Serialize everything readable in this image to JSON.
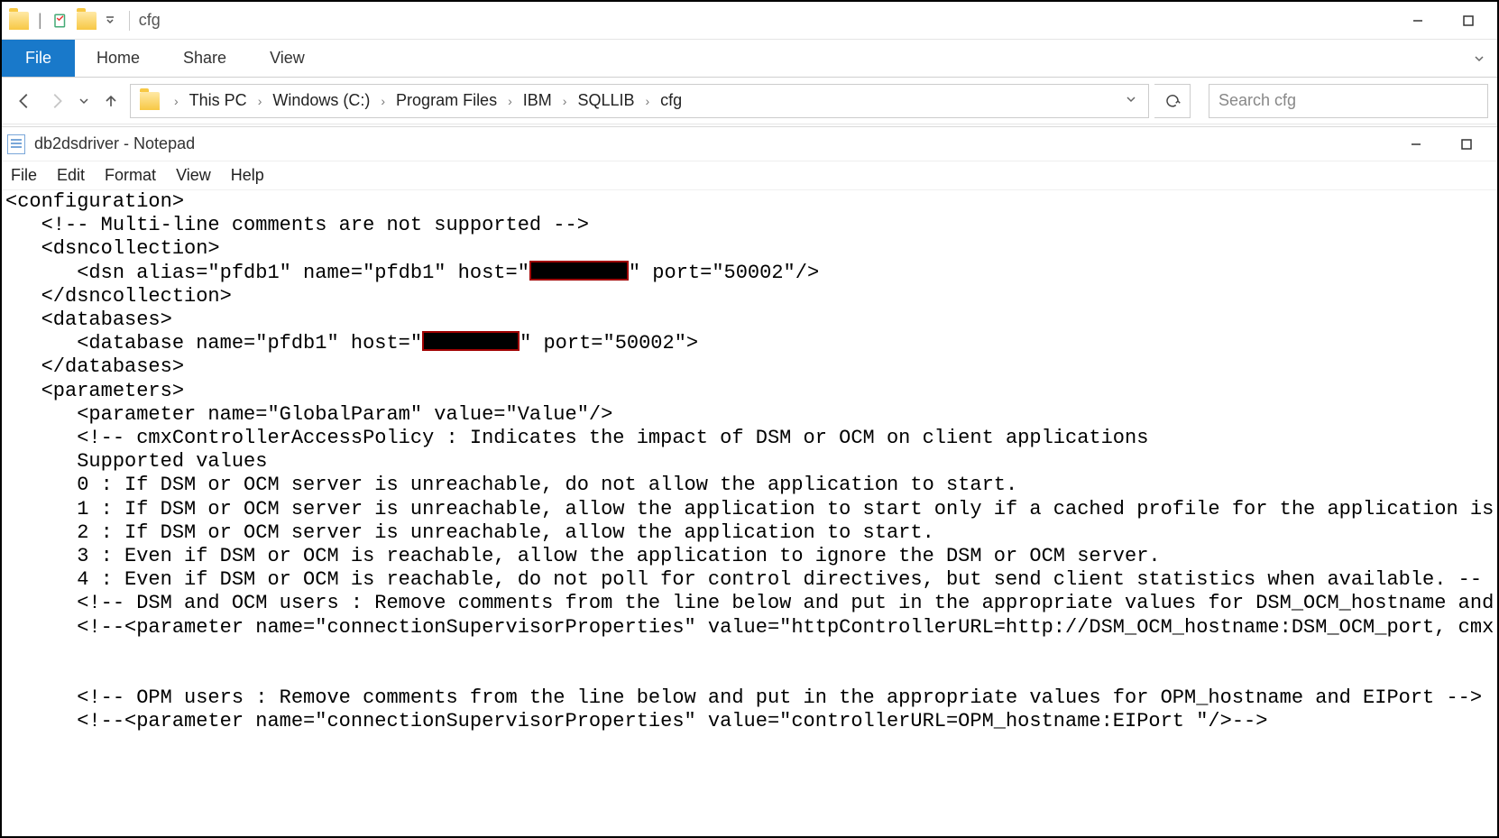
{
  "explorer": {
    "title": "cfg",
    "ribbon": {
      "file": "File",
      "home": "Home",
      "share": "Share",
      "view": "View"
    },
    "breadcrumbs": [
      "This PC",
      "Windows (C:)",
      "Program Files",
      "IBM",
      "SQLLIB",
      "cfg"
    ],
    "search_placeholder": "Search cfg"
  },
  "notepad": {
    "title": "db2dsdriver - Notepad",
    "menu": {
      "file": "File",
      "edit": "Edit",
      "format": "Format",
      "view": "View",
      "help": "Help"
    },
    "lines": {
      "l1": "<configuration>",
      "l2": "   <!-- Multi-line comments are not supported -->",
      "l3": "   <dsncollection>",
      "l4a": "      <dsn alias=\"pfdb1\" name=\"pfdb1\" host=\"",
      "l4b": "\" port=\"50002\"/>",
      "l5": "   </dsncollection>",
      "l6": "   <databases>",
      "l7a": "      <database name=\"pfdb1\" host=\"",
      "l7b": "\" port=\"50002\">",
      "l8": "   </databases>",
      "l9": "   <parameters>",
      "l10": "      <parameter name=\"GlobalParam\" value=\"Value\"/>",
      "l11": "      <!-- cmxControllerAccessPolicy : Indicates the impact of DSM or OCM on client applications",
      "l12": "      Supported values",
      "l13": "      0 : If DSM or OCM server is unreachable, do not allow the application to start.",
      "l14": "      1 : If DSM or OCM server is unreachable, allow the application to start only if a cached profile for the application is",
      "l15": "      2 : If DSM or OCM server is unreachable, allow the application to start.",
      "l16": "      3 : Even if DSM or OCM is reachable, allow the application to ignore the DSM or OCM server.",
      "l17": "      4 : Even if DSM or OCM is reachable, do not poll for control directives, but send client statistics when available. --",
      "l18": "      <!-- DSM and OCM users : Remove comments from the line below and put in the appropriate values for DSM_OCM_hostname and",
      "l19": "      <!--<parameter name=\"connectionSupervisorProperties\" value=\"httpControllerURL=http://DSM_OCM_hostname:DSM_OCM_port, cmx",
      "l20": "",
      "l21": "",
      "l22": "      <!-- OPM users : Remove comments from the line below and put in the appropriate values for OPM_hostname and EIPort -->",
      "l23": "      <!--<parameter name=\"connectionSupervisorProperties\" value=\"controllerURL=OPM_hostname:EIPort \"/>-->"
    }
  }
}
